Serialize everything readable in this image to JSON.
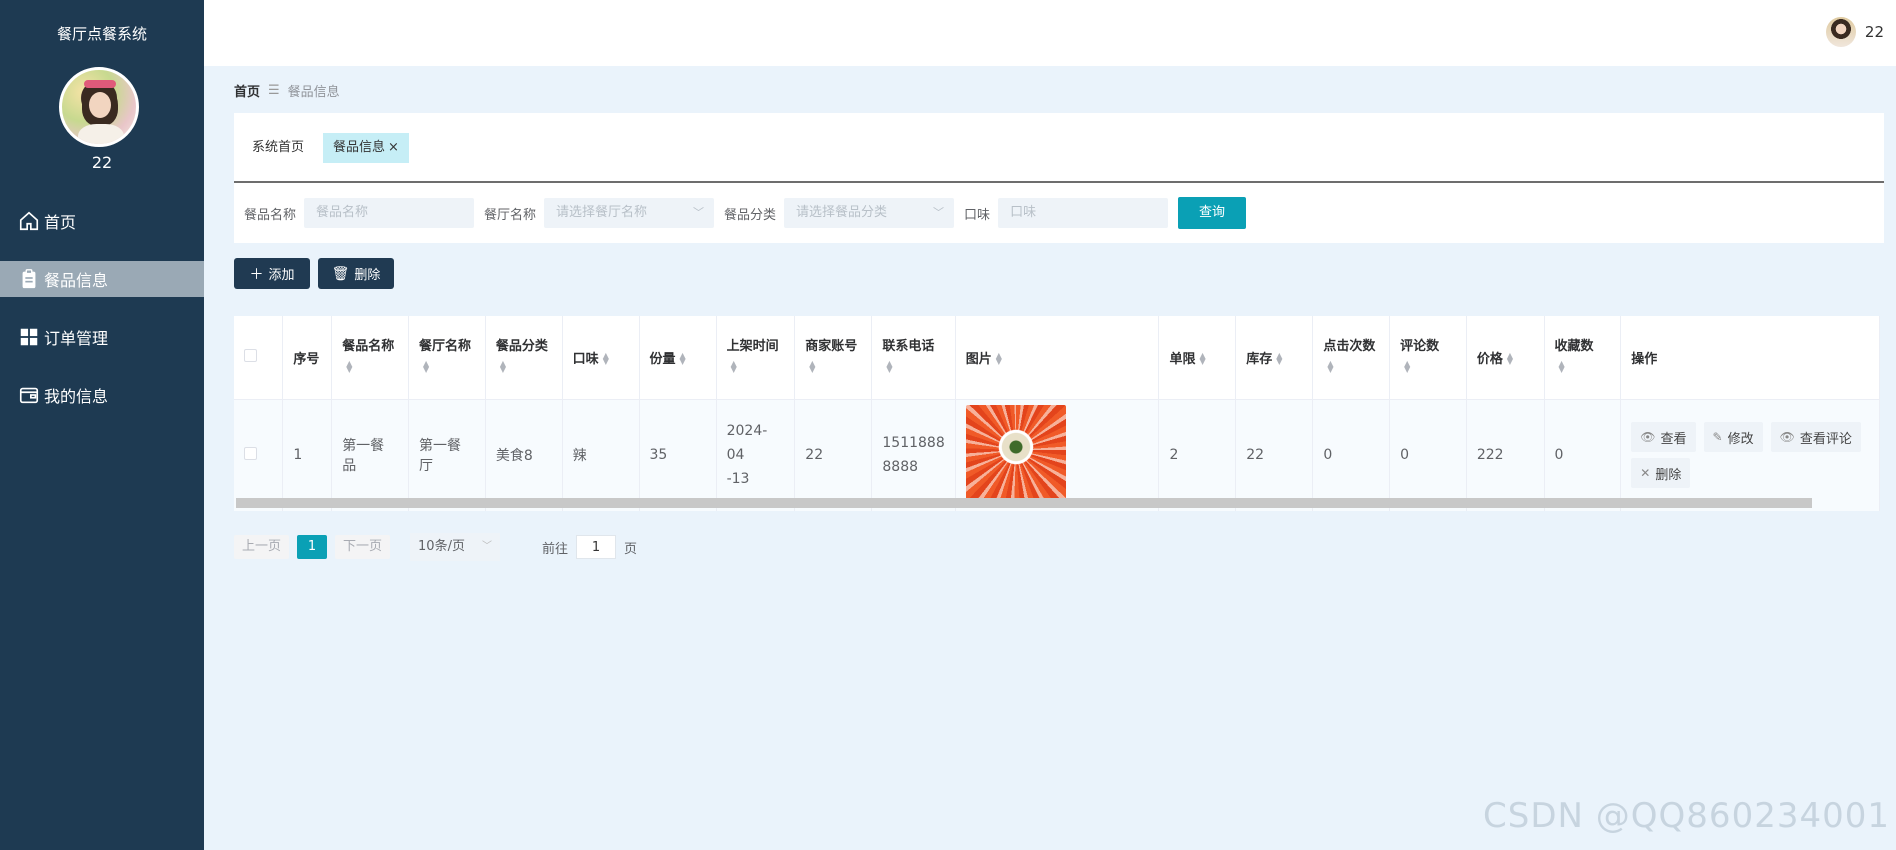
{
  "sidebar": {
    "title": "餐厅点餐系统",
    "username": "22",
    "items": [
      {
        "label": "首页",
        "icon": "home-icon"
      },
      {
        "label": "餐品信息",
        "icon": "clipboard-icon"
      },
      {
        "label": "订单管理",
        "icon": "grid-icon"
      },
      {
        "label": "我的信息",
        "icon": "wallet-icon"
      }
    ]
  },
  "topbar": {
    "username": "22"
  },
  "breadcrumb": {
    "home": "首页",
    "separator": "☰",
    "current": "餐品信息"
  },
  "tabs": [
    {
      "label": "系统首页"
    },
    {
      "label": "餐品信息",
      "close": "×"
    }
  ],
  "search": {
    "name_label": "餐品名称",
    "name_placeholder": "餐品名称",
    "restaurant_label": "餐厅名称",
    "restaurant_placeholder": "请选择餐厅名称",
    "category_label": "餐品分类",
    "category_placeholder": "请选择餐品分类",
    "taste_label": "口味",
    "taste_placeholder": "口味",
    "query_label": "查询"
  },
  "actions": {
    "add_label": "添加",
    "delete_label": "删除"
  },
  "table": {
    "headers": [
      "序号",
      "餐品名称",
      "餐厅名称",
      "餐品分类",
      "口味",
      "份量",
      "上架时间",
      "商家账号",
      "联系电话",
      "图片",
      "单限",
      "库存",
      "点击次数",
      "评论数",
      "价格",
      "收藏数",
      "操作"
    ],
    "rows": [
      {
        "index": "1",
        "name": "第一餐品",
        "restaurant": "第一餐厅",
        "category": "美食8",
        "taste": "辣",
        "portion": "35",
        "time": "2024-04-13",
        "time_line1": "2024-04",
        "time_line2": "-13",
        "merchant": "22",
        "phone_line1": "1511888",
        "phone_line2": "8888",
        "limit": "2",
        "stock": "22",
        "clicks": "0",
        "comments": "0",
        "price": "222",
        "favorites": "0",
        "ops": {
          "view": "查看",
          "edit": "修改",
          "view_comments": "查看评论",
          "delete": "删除"
        }
      }
    ]
  },
  "pager": {
    "prev": "上一页",
    "current": "1",
    "next": "下一页",
    "page_size": "10条/页",
    "goto_label": "前往",
    "goto_value": "1",
    "page_unit": "页"
  },
  "watermark": "CSDN @QQ860234001",
  "colors": {
    "sidebar": "#1e3a52",
    "accent": "#0aa0b5",
    "dark_button": "#203a52"
  }
}
